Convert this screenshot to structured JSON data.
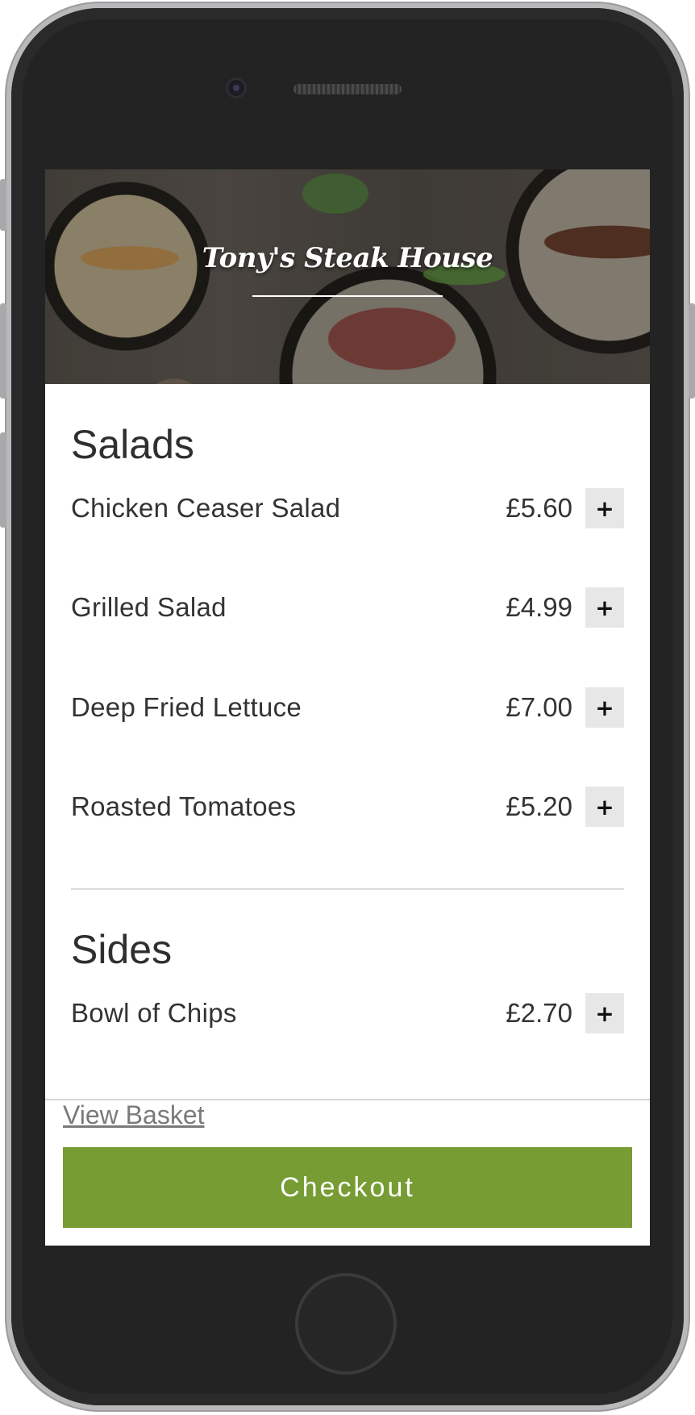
{
  "restaurant": {
    "name": "Tony's Steak House"
  },
  "menu": {
    "sections": [
      {
        "title": "Salads",
        "items": [
          {
            "name": "Chicken Ceaser Salad",
            "price": "£5.60",
            "add_label": "+"
          },
          {
            "name": "Grilled Salad",
            "price": "£4.99",
            "add_label": "+"
          },
          {
            "name": "Deep Fried Lettuce",
            "price": "£7.00",
            "add_label": "+"
          },
          {
            "name": "Roasted Tomatoes",
            "price": "£5.20",
            "add_label": "+"
          }
        ]
      },
      {
        "title": "Sides",
        "items": [
          {
            "name": "Bowl of Chips",
            "price": "£2.70",
            "add_label": "+"
          }
        ]
      }
    ]
  },
  "footer": {
    "view_basket_label": "View Basket",
    "checkout_label": "Checkout"
  },
  "colors": {
    "checkout": "#769c33",
    "add_button": "#e7e7e7",
    "text": "#333333"
  }
}
